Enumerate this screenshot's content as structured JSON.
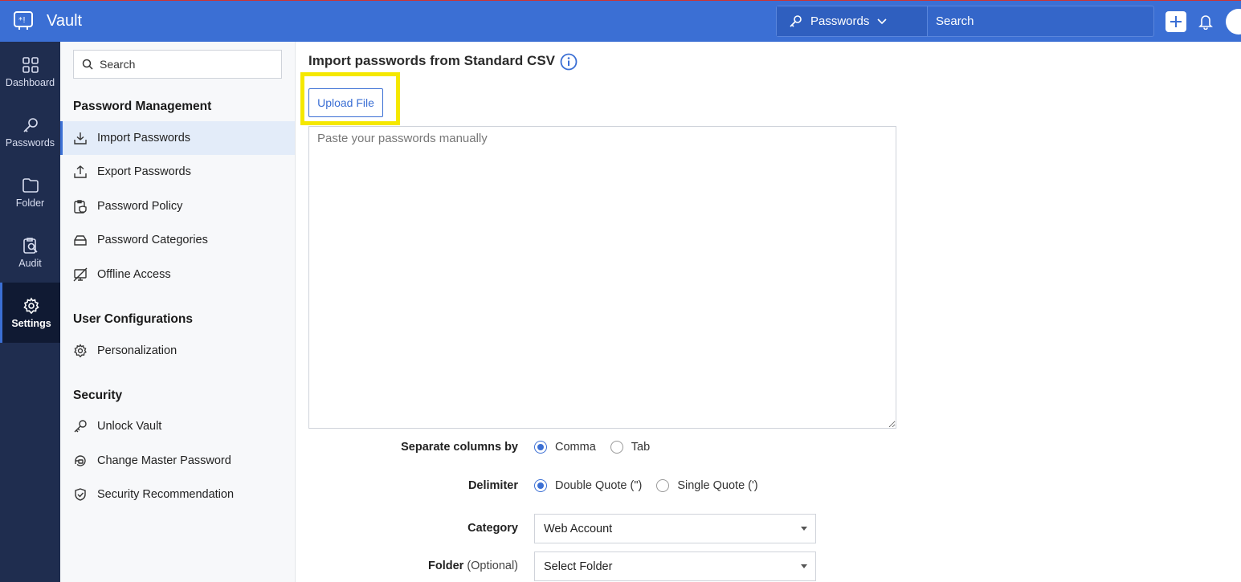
{
  "app": {
    "title": "Vault"
  },
  "topbar": {
    "scope_label": "Passwords",
    "search_placeholder": "Search"
  },
  "rail": {
    "items": [
      {
        "label": "Dashboard",
        "icon": "dashboard-icon"
      },
      {
        "label": "Passwords",
        "icon": "key-icon"
      },
      {
        "label": "Folder",
        "icon": "folder-icon"
      },
      {
        "label": "Audit",
        "icon": "audit-icon"
      },
      {
        "label": "Settings",
        "icon": "gear-icon",
        "active": true
      }
    ]
  },
  "sidebar": {
    "search_placeholder": "Search",
    "sections": [
      {
        "heading": "Password Management",
        "items": [
          {
            "label": "Import Passwords",
            "icon": "import-icon",
            "active": true
          },
          {
            "label": "Export Passwords",
            "icon": "export-icon"
          },
          {
            "label": "Password Policy",
            "icon": "policy-icon"
          },
          {
            "label": "Password Categories",
            "icon": "categories-icon"
          },
          {
            "label": "Offline Access",
            "icon": "offline-icon"
          }
        ]
      },
      {
        "heading": "User Configurations",
        "items": [
          {
            "label": "Personalization",
            "icon": "gear-icon"
          }
        ]
      },
      {
        "heading": "Security",
        "items": [
          {
            "label": "Unlock Vault",
            "icon": "unlock-icon"
          },
          {
            "label": "Change Master Password",
            "icon": "change-password-icon"
          },
          {
            "label": "Security Recommendation",
            "icon": "shield-icon"
          }
        ]
      }
    ]
  },
  "main": {
    "title": "Import passwords from Standard CSV",
    "upload_label": "Upload File",
    "paste_placeholder": "Paste your passwords manually",
    "separate_label": "Separate columns by",
    "separate_options": [
      "Comma",
      "Tab"
    ],
    "separate_selected": "Comma",
    "delimiter_label": "Delimiter",
    "delimiter_options": [
      "Double Quote (\")",
      "Single Quote (')"
    ],
    "delimiter_selected": "Double Quote (\")",
    "category_label": "Category",
    "category_value": "Web Account",
    "folder_label": "Folder",
    "folder_optional": "(Optional)",
    "folder_value": "Select Folder"
  },
  "colors": {
    "topbar": "#3b6fd4",
    "rail": "#1f2d4f",
    "accent": "#3b6fd4",
    "highlight": "#f5e800"
  }
}
